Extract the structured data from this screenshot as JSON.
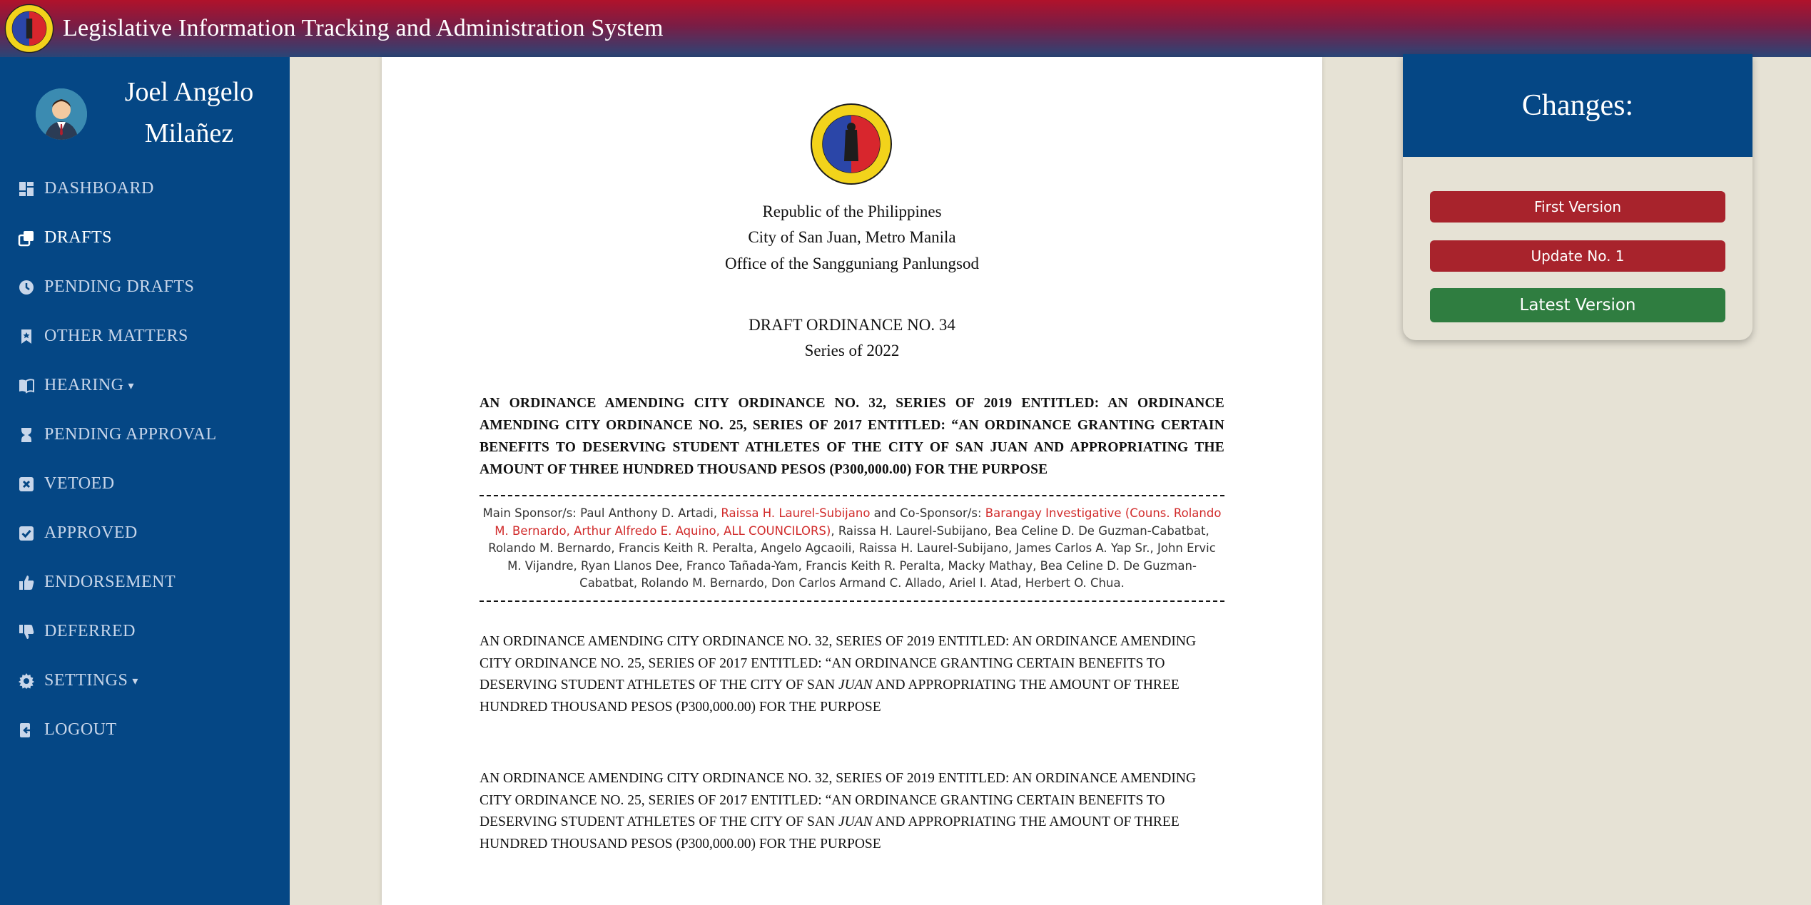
{
  "app": {
    "title": "Legislative Information Tracking and Administration System"
  },
  "user": {
    "name": "Joel Angelo Milañez"
  },
  "sidebar": {
    "items": [
      {
        "label": "DASHBOARD",
        "icon": "dashboard-icon",
        "active": false
      },
      {
        "label": "DRAFTS",
        "icon": "copy-icon",
        "active": true
      },
      {
        "label": "PENDING DRAFTS",
        "icon": "clock-icon",
        "active": false
      },
      {
        "label": "OTHER MATTERS",
        "icon": "bookmark-icon",
        "active": false
      },
      {
        "label": "HEARING",
        "icon": "book-icon",
        "active": false,
        "dropdown": true
      },
      {
        "label": "PENDING APPROVAL",
        "icon": "hourglass-icon",
        "active": false
      },
      {
        "label": "VETOED",
        "icon": "x-square-icon",
        "active": false
      },
      {
        "label": "APPROVED",
        "icon": "check-square-icon",
        "active": false
      },
      {
        "label": "ENDORSEMENT",
        "icon": "thumbs-up-icon",
        "active": false
      },
      {
        "label": "DEFERRED",
        "icon": "thumbs-down-icon",
        "active": false
      },
      {
        "label": "SETTINGS",
        "icon": "gear-icon",
        "active": false,
        "dropdown": true
      },
      {
        "label": "LOGOUT",
        "icon": "logout-icon",
        "active": false
      }
    ]
  },
  "document": {
    "header_lines": [
      "Republic of the Philippines",
      "City of San Juan, Metro Manila",
      "Office of the Sangguniang Panlungsod"
    ],
    "draft_no": "DRAFT ORDINANCE NO. 34",
    "series": "Series of 2022",
    "title": "AN ORDINANCE AMENDING CITY ORDINANCE NO. 32, SERIES OF 2019 ENTITLED: AN ORDINANCE AMENDING CITY ORDINANCE NO. 25, SERIES OF 2017 ENTITLED: “AN ORDINANCE GRANTING CERTAIN BENEFITS TO DESERVING STUDENT ATHLETES OF THE CITY OF SAN JUAN AND APPROPRIATING THE AMOUNT OF THREE HUNDRED THOUSAND PESOS (P300,000.00) FOR THE PURPOSE",
    "sponsors": {
      "main_label": "Main Sponsor/s: Paul Anthony D. Artadi, ",
      "main_red": "Raissa H. Laurel-Subijano",
      "co_label": " and Co-Sponsor/s: ",
      "co_red": "Barangay Investigative (Couns. Rolando M. Bernardo, Arthur Alfredo E. Aquino, ALL COUNCILORS)",
      "co_rest": ", Raissa H. Laurel-Subijano, Bea Celine D. De Guzman-Cabatbat, Rolando M. Bernardo, Francis Keith R. Peralta, Angelo Agcaoili, Raissa H. Laurel-Subijano, James Carlos A. Yap Sr., John Ervic M. Vijandre, Ryan Llanos Dee, Franco Tañada-Yam, Francis Keith R. Peralta, Macky Mathay, Bea Celine D. De Guzman-Cabatbat, Rolando M. Bernardo, Don Carlos Armand C. Allado, Ariel I. Atad, Herbert O. Chua."
    },
    "body_paragraphs": [
      {
        "before": "AN ORDINANCE AMENDING CITY ORDINANCE NO. 32, SERIES OF 2019 ENTITLED: AN ORDINANCE AMENDING CITY ORDINANCE NO. 25, SERIES OF 2017 ENTITLED: “AN ORDINANCE GRANTING CERTAIN BENEFITS TO DESERVING STUDENT ATHLETES OF THE CITY OF SAN ",
        "italic": "JUAN",
        "after": " AND APPROPRIATING THE AMOUNT OF THREE HUNDRED THOUSAND PESOS (P300,000.00) FOR THE PURPOSE"
      },
      {
        "before": "AN ORDINANCE AMENDING CITY ORDINANCE NO. 32, SERIES OF 2019 ENTITLED: AN ORDINANCE AMENDING CITY ORDINANCE NO. 25, SERIES OF 2017 ENTITLED: “AN ORDINANCE GRANTING CERTAIN BENEFITS TO DESERVING STUDENT ATHLETES OF THE CITY OF SAN ",
        "italic": "JUAN",
        "after": " AND APPROPRIATING THE AMOUNT OF THREE HUNDRED THOUSAND PESOS (P300,000.00) FOR THE PURPOSE"
      }
    ]
  },
  "changes": {
    "title": "Changes:",
    "first_version": "First Version",
    "update_1": "Update No. 1",
    "latest_version": "Latest Version"
  },
  "colors": {
    "sidebar_bg": "#054785",
    "accent_red": "#a8232c",
    "accent_green": "#2f7d40",
    "page_bg": "#e6e2d5"
  }
}
